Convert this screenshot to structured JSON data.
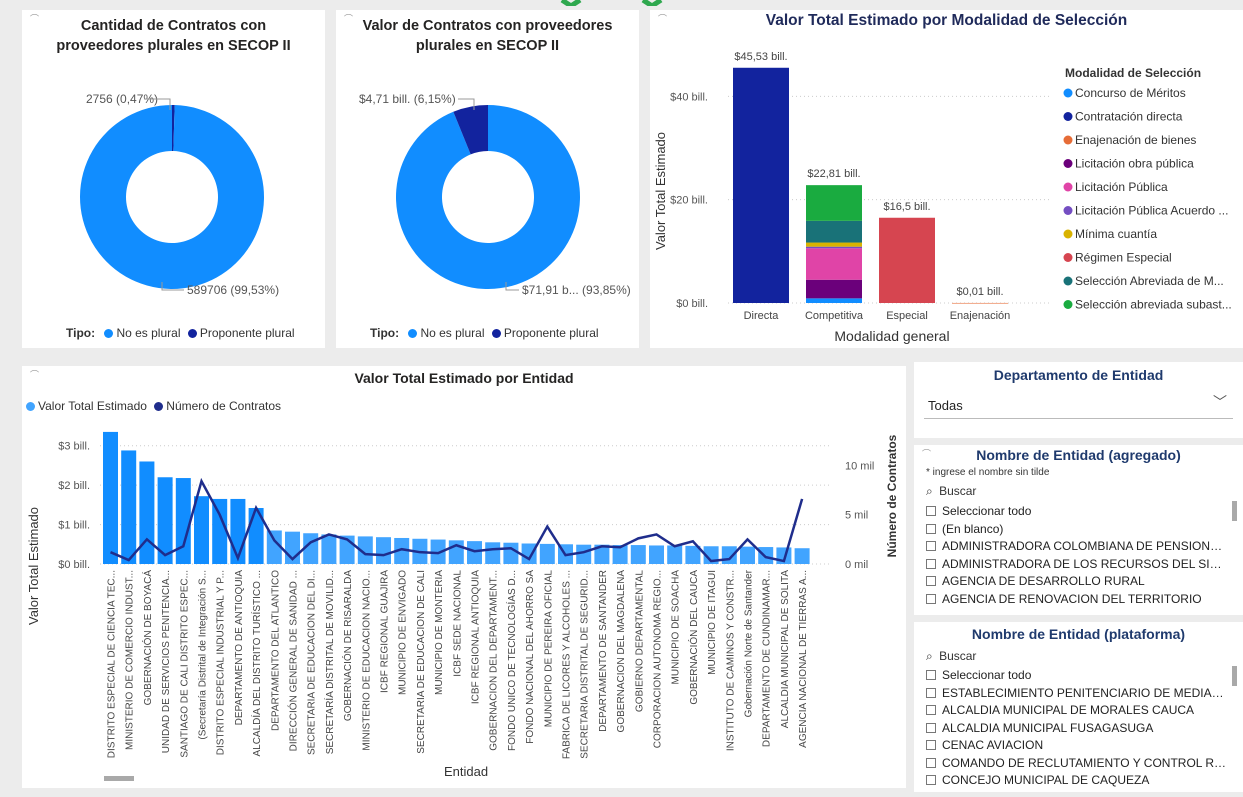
{
  "colors": {
    "light_blue": "#118DFF",
    "dark_blue": "#12239E",
    "bar_light": "#41A4FF",
    "line_dark": "#1F2D8C",
    "slicer_title": "#1F3A6D",
    "logo_green": "#2FA84F"
  },
  "donut1": {
    "title": "Cantidad de Contratos con proveedores plurales en SECOP II",
    "label_small": "2756 (0,47%)",
    "label_large": "589706 (99,53%)",
    "legend_prefix": "Tipo:",
    "legend_items": [
      "No es plural",
      "Proponente plural"
    ]
  },
  "donut2": {
    "title": "Valor de Contratos con proveedores plurales en SECOP II",
    "label_small": "$4,71 bill. (6,15%)",
    "label_large": "$71,91 b... (93,85%)",
    "legend_prefix": "Tipo:",
    "legend_items": [
      "No es plural",
      "Proponente plural"
    ]
  },
  "bar_chart": {
    "title": "Valor Total Estimado por Modalidad de Selección",
    "ylabel": "Valor Total Estimado",
    "xlabel": "Modalidad general",
    "legend_title": "Modalidad de Selección",
    "legend": [
      {
        "name": "Concurso de Méritos",
        "color": "#118DFF"
      },
      {
        "name": "Contratación directa",
        "color": "#12239E"
      },
      {
        "name": "Enajenación de bienes",
        "color": "#E66C37"
      },
      {
        "name": "Licitación obra pública",
        "color": "#6B007B"
      },
      {
        "name": "Licitación Pública",
        "color": "#E044A7"
      },
      {
        "name": "Licitación Pública Acuerdo ...",
        "color": "#744EC2"
      },
      {
        "name": "Mínima cuantía",
        "color": "#D9B300"
      },
      {
        "name": "Régimen Especial",
        "color": "#D64550"
      },
      {
        "name": "Selección Abreviada de M...",
        "color": "#197278"
      },
      {
        "name": "Selección abreviada subast...",
        "color": "#1AAB40"
      }
    ],
    "y_ticks": [
      "$0 bill.",
      "$20 bill.",
      "$40 bill."
    ],
    "total_labels": [
      "$45,53 bill.",
      "$22,81 bill.",
      "$16,5 bill.",
      "$0,01 bill."
    ]
  },
  "combo_chart": {
    "title": "Valor Total Estimado por Entidad",
    "legend": [
      "Valor Total Estimado",
      "Número de Contratos"
    ],
    "ylabel_left": "Valor Total Estimado",
    "ylabel_right": "Número de Contratos",
    "xlabel": "Entidad",
    "y_ticks_left": [
      "$0 bill.",
      "$1 bill.",
      "$2 bill.",
      "$3 bill."
    ],
    "y_ticks_right": [
      "0 mil",
      "5 mil",
      "10 mil"
    ]
  },
  "chart_data": [
    {
      "type": "pie",
      "title": "Cantidad de Contratos con proveedores plurales en SECOP II",
      "legend_title": "Tipo:",
      "categories": [
        "No es plural",
        "Proponente plural"
      ],
      "values": [
        589706,
        2756
      ],
      "percent_labels": [
        "99,53%",
        "0,47%"
      ],
      "donut": true
    },
    {
      "type": "pie",
      "title": "Valor de Contratos con proveedores plurales en SECOP II",
      "legend_title": "Tipo:",
      "categories": [
        "No es plural",
        "Proponente plural"
      ],
      "values": [
        71.91,
        4.71
      ],
      "value_labels": [
        "$71,91 b...",
        "$4,71 bill."
      ],
      "percent_labels": [
        "93,85%",
        "6,15%"
      ],
      "donut": true
    },
    {
      "type": "bar",
      "stacked": true,
      "title": "Valor Total Estimado por Modalidad de Selección",
      "xlabel": "Modalidad general",
      "ylabel": "Valor Total Estimado",
      "categories": [
        "Directa",
        "Competitiva",
        "Especial",
        "Enajenación"
      ],
      "ylim": [
        0,
        48
      ],
      "totals": [
        45.53,
        22.81,
        16.5,
        0.01
      ],
      "series": [
        {
          "name": "Concurso de Méritos",
          "values": [
            0,
            0.9,
            0,
            0
          ]
        },
        {
          "name": "Contratación directa",
          "values": [
            45.53,
            0,
            0,
            0
          ]
        },
        {
          "name": "Enajenación de bienes",
          "values": [
            0,
            0,
            0,
            0.01
          ]
        },
        {
          "name": "Licitación obra pública",
          "values": [
            0,
            3.6,
            0,
            0
          ]
        },
        {
          "name": "Licitación Pública",
          "values": [
            0,
            6.1,
            0,
            0
          ]
        },
        {
          "name": "Licitación Pública Acuerdo ...",
          "values": [
            0,
            0.3,
            0,
            0
          ]
        },
        {
          "name": "Mínima cuantía",
          "values": [
            0,
            0.8,
            0,
            0
          ]
        },
        {
          "name": "Régimen Especial",
          "values": [
            0,
            0,
            16.5,
            0
          ]
        },
        {
          "name": "Selección Abreviada de M...",
          "values": [
            0,
            4.2,
            0,
            0
          ]
        },
        {
          "name": "Selección abreviada subast...",
          "values": [
            0,
            6.91,
            0,
            0
          ]
        }
      ],
      "legend_position": "right"
    },
    {
      "type": "bar",
      "combo_line": true,
      "title": "Valor Total Estimado por Entidad",
      "xlabel": "Entidad",
      "ylabel": "Valor Total Estimado",
      "y2label": "Número de Contratos",
      "ylim": [
        0,
        3.5
      ],
      "y2lim": [
        0,
        14000
      ],
      "categories": [
        "DISTRITO ESPECIAL DE CIENCIA TEC...",
        "MINISTERIO DE COMERCIO INDUST...",
        "GOBERNACIÓN DE BOYACÁ",
        "UNIDAD DE SERVICIOS PENITENCIA...",
        "SANTIAGO DE CALI DISTRITO ESPEC...",
        "(Secretaría Distrital de Integración S...",
        "DISTRITO ESPECIAL INDUSTRIAL Y P...",
        "DEPARTAMENTO DE ANTIOQUIA",
        "ALCALDÍA DEL DISTRITO TURÍSTICO ...",
        "DEPARTAMENTO DEL ATLANTICO",
        "DIRECCIÓN GENERAL DE SANIDAD ...",
        "SECRETARIA DE EDUCACION DEL DI...",
        "SECRETARÍA DISTRITAL DE MOVILID...",
        "GOBERNACIÓN DE RISARALDA",
        "MINISTERIO DE EDUCACION NACIO...",
        "ICBF REGIONAL GUAJIRA",
        "MUNICIPIO DE ENVIGADO",
        "SECRETARIA DE EDUCACION DE CALI",
        "MUNICIPIO DE MONTERIA",
        "ICBF SEDE NACIONAL",
        "ICBF REGIONAL ANTIOQUIA",
        "GOBERNACION DEL DEPARTAMENT...",
        "FONDO UNICO DE TECNOLOGÍAS D...",
        "FONDO NACIONAL DEL AHORRO SA",
        "MUNICIPIO DE PEREIRA OFICIAL",
        "FABRICA DE LICORES Y ALCOHOLES ...",
        "SECRETARIA DISTRITAL DE SEGURID...",
        "DEPARTAMENTO DE SANTANDER",
        "GOBERNACION DEL MAGDALENA",
        "GOBIERNO DEPARTAMENTAL",
        "CORPORACION AUTONOMA REGIO...",
        "MUNICIPIO DE SOACHA",
        "GOBERNACIÓN DEL CAUCA",
        "MUNICIPIO DE ITAGUI",
        "INSTITUTO DE CAMINOS Y CONSTR...",
        "Gobernación Norte de Santander",
        "DEPARTAMENTO DE CUNDINAMAR...",
        "ALCALDIA MUNICIPAL DE SOLITA",
        "AGENCIA NACIONAL DE TIERRAS A..."
      ],
      "series": [
        {
          "name": "Valor Total Estimado",
          "axis": "left",
          "values": [
            3.35,
            2.88,
            2.6,
            2.2,
            2.18,
            1.72,
            1.65,
            1.65,
            1.42,
            0.85,
            0.82,
            0.78,
            0.75,
            0.72,
            0.7,
            0.68,
            0.66,
            0.64,
            0.62,
            0.6,
            0.58,
            0.55,
            0.54,
            0.52,
            0.51,
            0.5,
            0.49,
            0.49,
            0.48,
            0.48,
            0.47,
            0.47,
            0.46,
            0.45,
            0.45,
            0.44,
            0.43,
            0.42,
            0.4
          ]
        },
        {
          "name": "Número de Contratos",
          "axis": "right",
          "values": [
            1200,
            400,
            2500,
            900,
            1800,
            8400,
            5000,
            600,
            5700,
            2400,
            500,
            2200,
            3000,
            2500,
            1000,
            900,
            1500,
            1200,
            1100,
            1900,
            1300,
            1500,
            1600,
            500,
            3800,
            900,
            1200,
            1800,
            1700,
            2600,
            3000,
            1800,
            2300,
            300,
            500,
            2500,
            700,
            300,
            6600
          ]
        }
      ],
      "legend_position": "top-left"
    }
  ],
  "slicer_departamento": {
    "title": "Departamento de Entidad",
    "value": "Todas"
  },
  "slicer_agregado": {
    "title": "Nombre de Entidad (agregado)",
    "hint": "* ingrese el nombre sin tilde",
    "search_placeholder": "Buscar",
    "items": [
      "Seleccionar todo",
      "(En blanco)",
      "ADMINISTRADORA COLOMBIANA DE PENSIONES (...",
      "ADMINISTRADORA DE LOS RECURSOS DEL SISTEM...",
      "AGENCIA DE DESARROLLO RURAL",
      "AGENCIA DE RENOVACION DEL TERRITORIO"
    ]
  },
  "slicer_plataforma": {
    "title": "Nombre de Entidad (plataforma)",
    "search_placeholder": "Buscar",
    "items": [
      "Seleccionar todo",
      "ESTABLECIMIENTO PENITENCIARIO DE MEDIANA SE...",
      "ALCALDIA MUNICIPAL DE MORALES CAUCA",
      "ALCALDIA MUNICIPAL FUSAGASUGA",
      "CENAC AVIACION",
      "COMANDO DE RECLUTAMIENTO Y CONTROL RESER...",
      "CONCEJO MUNICIPAL DE CAQUEZA"
    ]
  }
}
